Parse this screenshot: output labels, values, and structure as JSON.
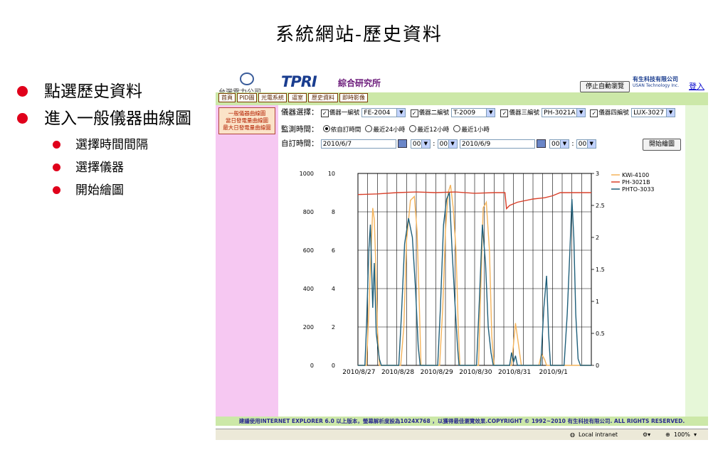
{
  "slide": {
    "title": "系統網站-歷史資料",
    "bullets": [
      {
        "text": "點選歷史資料",
        "level": 1
      },
      {
        "text": "進入一般儀器曲線圖",
        "level": 1
      },
      {
        "text": "選擇時間間隔",
        "level": 2
      },
      {
        "text": "選擇儀器",
        "level": 2
      },
      {
        "text": "開始繪圖",
        "level": 2
      }
    ]
  },
  "site": {
    "gov_logo_text": "台灣電力公司",
    "brand": "TPRI",
    "brand_cn": "綜合研究所",
    "stop_button": "停止自動瀏覽",
    "company_cn": "有生科技有限公司",
    "company_en": "USAN Technology Inc.",
    "login": "登入",
    "nav": [
      "首頁",
      "PID圖",
      "光電系統",
      "逼室",
      "歷史資料",
      "即時影像"
    ],
    "side_links": [
      "一般儀器曲線圖",
      "當日發電量曲線圖",
      "最大日發電量曲線圖"
    ]
  },
  "form": {
    "instrument_label": "儀器選擇：",
    "instruments": [
      {
        "label": "儀器一編號",
        "value": "FE-2004",
        "checked": true
      },
      {
        "label": "儀器二編號",
        "value": "T-2009",
        "checked": true
      },
      {
        "label": "儀器三編號",
        "value": "PH-3021A",
        "checked": true
      },
      {
        "label": "儀器四編號",
        "value": "LUX-3027",
        "checked": true
      }
    ],
    "monitor_label": "監測時間：",
    "monitor_options": [
      "依自訂時間",
      "最近24小時",
      "最近12小時",
      "最近1小時"
    ],
    "monitor_selected": 0,
    "custom_label": "自訂時間：",
    "start_date": "2010/6/7",
    "start_hour": "00",
    "start_min": "00",
    "end_date": "2010/6/9",
    "end_hour": "00",
    "end_min": "00",
    "time_sep": ":",
    "draw_button": "開始繪圖"
  },
  "chart_data": {
    "type": "line",
    "x_ticks": [
      "2010/8/27",
      "2010/8/28",
      "2010/8/29",
      "2010/8/30",
      "2010/8/31",
      "2010/9/1"
    ],
    "x_range_days": [
      0,
      6
    ],
    "y_left1_ticks": [
      0,
      200,
      400,
      600,
      800,
      1000
    ],
    "y_left2_ticks": [
      0,
      2,
      4,
      6,
      8,
      10
    ],
    "y_right_ticks": [
      0,
      0.5,
      1,
      1.5,
      2,
      2.5,
      3
    ],
    "ylim_left1": [
      0,
      1000
    ],
    "ylim_right": [
      0,
      3
    ],
    "grid": true,
    "legend_position": "top-right",
    "series": [
      {
        "name": "KWi-4100",
        "color": "#f4b35a",
        "axis": "left1",
        "points": [
          [
            0.0,
            0
          ],
          [
            0.22,
            0
          ],
          [
            0.26,
            180
          ],
          [
            0.32,
            500
          ],
          [
            0.38,
            820
          ],
          [
            0.42,
            760
          ],
          [
            0.46,
            520
          ],
          [
            0.5,
            200
          ],
          [
            0.55,
            0
          ],
          [
            1.1,
            0
          ],
          [
            1.18,
            200
          ],
          [
            1.25,
            650
          ],
          [
            1.35,
            860
          ],
          [
            1.45,
            880
          ],
          [
            1.52,
            700
          ],
          [
            1.58,
            300
          ],
          [
            1.62,
            0
          ],
          [
            2.1,
            0
          ],
          [
            2.18,
            300
          ],
          [
            2.25,
            700
          ],
          [
            2.32,
            900
          ],
          [
            2.38,
            940
          ],
          [
            2.45,
            820
          ],
          [
            2.52,
            600
          ],
          [
            2.58,
            200
          ],
          [
            2.62,
            0
          ],
          [
            3.1,
            0
          ],
          [
            3.15,
            350
          ],
          [
            3.22,
            820
          ],
          [
            3.3,
            850
          ],
          [
            3.38,
            600
          ],
          [
            3.44,
            150
          ],
          [
            3.5,
            0
          ],
          [
            3.95,
            0
          ],
          [
            4.05,
            220
          ],
          [
            4.12,
            120
          ],
          [
            4.2,
            0
          ],
          [
            4.65,
            0
          ],
          [
            4.72,
            60
          ],
          [
            4.8,
            30
          ],
          [
            4.85,
            0
          ],
          [
            6.0,
            0
          ]
        ]
      },
      {
        "name": "PH-3021B",
        "color": "#d9412b",
        "axis": "right",
        "points": [
          [
            0,
            2.67
          ],
          [
            0.5,
            2.68
          ],
          [
            1.0,
            2.7
          ],
          [
            1.5,
            2.71
          ],
          [
            2.0,
            2.7
          ],
          [
            2.5,
            2.71
          ],
          [
            3.0,
            2.69
          ],
          [
            3.5,
            2.7
          ],
          [
            3.78,
            2.7
          ],
          [
            3.82,
            2.45
          ],
          [
            3.9,
            2.5
          ],
          [
            4.1,
            2.55
          ],
          [
            4.5,
            2.6
          ],
          [
            4.8,
            2.62
          ],
          [
            5.0,
            2.65
          ],
          [
            5.2,
            2.7
          ],
          [
            5.5,
            2.7
          ],
          [
            6.0,
            2.7
          ]
        ]
      },
      {
        "name": "PHTO-3033",
        "color": "#1f5f7a",
        "axis": "right",
        "points": [
          [
            0,
            0
          ],
          [
            0.18,
            0
          ],
          [
            0.22,
            0.6
          ],
          [
            0.28,
            1.8
          ],
          [
            0.32,
            2.2
          ],
          [
            0.38,
            0.9
          ],
          [
            0.42,
            1.6
          ],
          [
            0.47,
            0.5
          ],
          [
            0.55,
            0.1
          ],
          [
            0.6,
            0
          ],
          [
            1.05,
            0
          ],
          [
            1.12,
            0.8
          ],
          [
            1.2,
            1.9
          ],
          [
            1.3,
            2.3
          ],
          [
            1.4,
            2.0
          ],
          [
            1.48,
            1.2
          ],
          [
            1.55,
            0.3
          ],
          [
            1.6,
            0
          ],
          [
            2.05,
            0
          ],
          [
            2.12,
            0.9
          ],
          [
            2.2,
            2.2
          ],
          [
            2.28,
            2.6
          ],
          [
            2.35,
            2.7
          ],
          [
            2.42,
            1.8
          ],
          [
            2.5,
            0.9
          ],
          [
            2.56,
            0.3
          ],
          [
            2.6,
            0
          ],
          [
            3.05,
            0
          ],
          [
            3.12,
            1.0
          ],
          [
            3.2,
            2.2
          ],
          [
            3.28,
            1.6
          ],
          [
            3.35,
            0.6
          ],
          [
            3.42,
            0.2
          ],
          [
            3.48,
            0
          ],
          [
            3.9,
            0
          ],
          [
            3.95,
            0.2
          ],
          [
            4.0,
            0.05
          ],
          [
            4.05,
            0.15
          ],
          [
            4.1,
            0
          ],
          [
            4.7,
            0
          ],
          [
            4.78,
            0.9
          ],
          [
            4.85,
            1.4
          ],
          [
            4.9,
            0.5
          ],
          [
            4.95,
            0
          ],
          [
            5.3,
            0
          ],
          [
            5.38,
            0.8
          ],
          [
            5.45,
            1.8
          ],
          [
            5.5,
            2.6
          ],
          [
            5.55,
            2.0
          ],
          [
            5.6,
            0.8
          ],
          [
            5.66,
            0.1
          ],
          [
            5.72,
            0
          ],
          [
            6.0,
            0
          ]
        ]
      }
    ]
  },
  "footer": "建議使用INTERNET EXPLORER 6.0 以上版本，螢幕解析度設為1024X768 ，以獲得最佳瀏覽效果.COPYRIGHT © 1992~2010 有生科技有限公司. ALL RIGHTS RESERVED.",
  "statusbar": {
    "zone": "Local intranet",
    "zoom": "100%"
  }
}
